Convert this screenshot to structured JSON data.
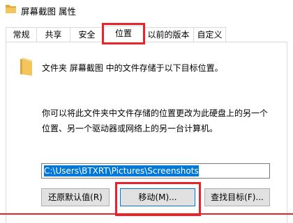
{
  "window": {
    "title": "屏幕截图 属性"
  },
  "tabs": [
    {
      "label": "常规"
    },
    {
      "label": "共享"
    },
    {
      "label": "安全"
    },
    {
      "label": "位置",
      "selected": true
    },
    {
      "label": "以前的版本"
    },
    {
      "label": "自定义"
    }
  ],
  "location": {
    "description": "文件夹 屏幕截图 中的文件存储于以下目标位置。",
    "info_line1": "你可以将此文件夹中文件存储的位置更改为此硬盘上的另一个",
    "info_line2": "位置、另一个驱动器或网络上的另一台计算机。",
    "path_value": "C:\\Users\\BTXRT\\Pictures\\Screenshots"
  },
  "buttons": {
    "restore_default": "还原默认值(R)",
    "move": "移动(M)...",
    "find_target": "查找目标(F)..."
  },
  "colors": {
    "highlight": "#e8242a",
    "selection": "#0078d7",
    "folder": "#f3c55a"
  },
  "icons": {
    "title": "folder-icon",
    "location": "folder-icon"
  }
}
